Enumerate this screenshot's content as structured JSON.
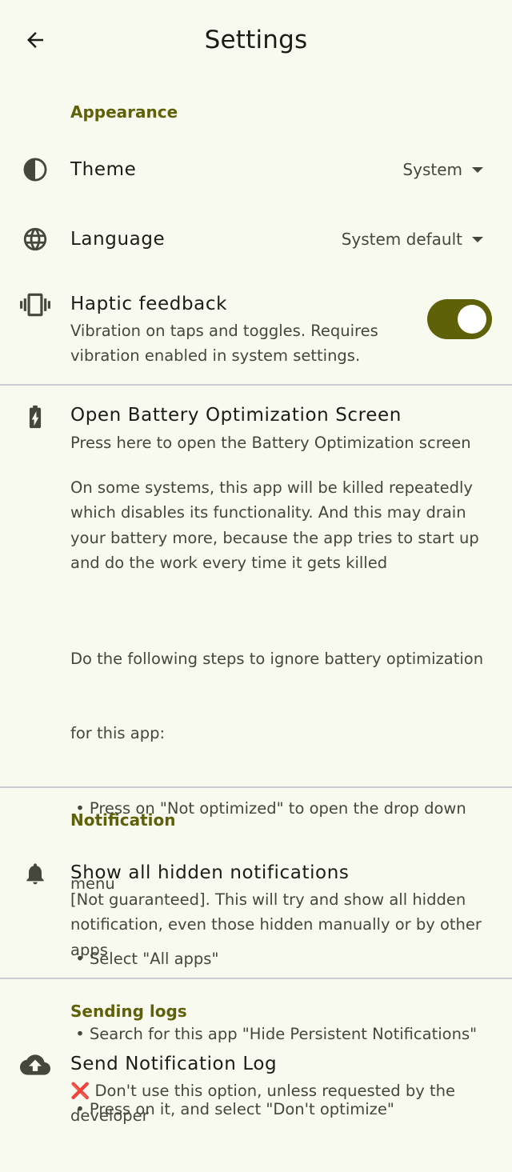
{
  "header": {
    "title": "Settings",
    "back_icon": "arrow-back-icon"
  },
  "sections": {
    "appearance": "Appearance",
    "notification": "Notification",
    "sending_logs": "Sending logs"
  },
  "theme": {
    "title": "Theme",
    "value": "System",
    "icon": "contrast-icon"
  },
  "language": {
    "title": "Language",
    "value": "System default",
    "icon": "globe-icon"
  },
  "haptic": {
    "title": "Haptic feedback",
    "desc": [
      "Vibration on taps and toggles. Requires",
      "vibration enabled in system settings."
    ],
    "enabled": true,
    "icon": "vibration-icon"
  },
  "battery": {
    "title": "Open Battery Optimization Screen",
    "icon": "battery-charging-icon",
    "desc": [
      "Press here to open the Battery Optimization screen"
    ],
    "para1": [
      "On some systems, this app will be killed repeatedly",
      "which disables its functionality. And this may drain",
      "your battery more, because the app tries to start up",
      "and do the work every time it gets killed"
    ],
    "para2": [
      "Do the following steps to ignore battery optimization",
      "for this app:",
      " • Press on \"Not optimized\" to open the drop down",
      "menu",
      " • Select \"All apps\"",
      " • Search for this app \"Hide Persistent Notifications\"",
      " • Press on it, and select \"Don't optimize\""
    ]
  },
  "show_hidden": {
    "title": "Show all hidden notifications",
    "icon": "bell-icon",
    "desc": [
      "[Not guaranteed]. This will try and show all hidden",
      "notification, even those hidden manually or by other",
      "apps"
    ]
  },
  "send_log": {
    "title": "Send Notification Log",
    "icon": "cloud-upload-icon",
    "desc": [
      "❌ Don't use this option, unless requested by the",
      "developer"
    ]
  },
  "colors": {
    "background": "#f9faef",
    "accent": "#5f6108",
    "text": "#1b1c16",
    "secondary_text": "#45473b",
    "divider": "#c9ccd4"
  }
}
